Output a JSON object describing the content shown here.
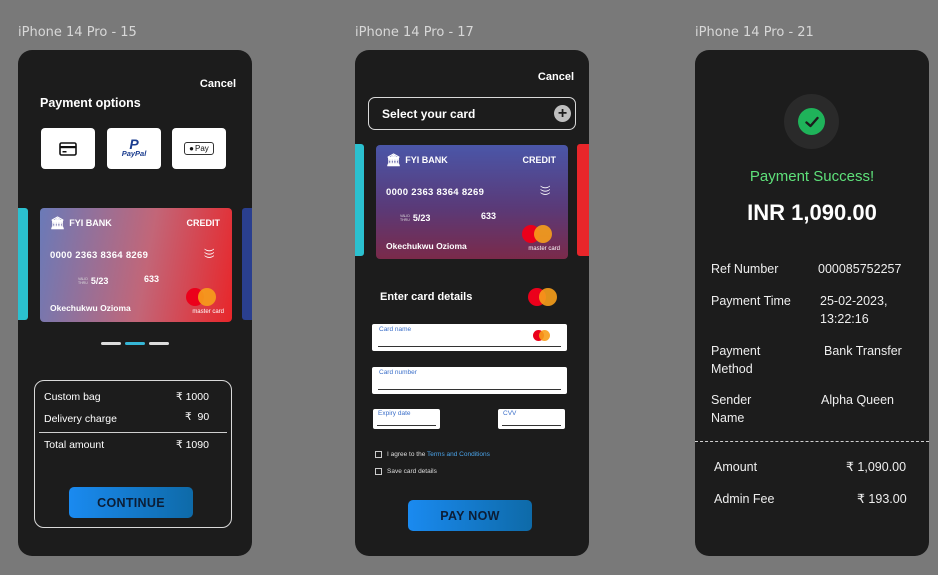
{
  "frames": [
    {
      "label": "iPhone 14 Pro - 15"
    },
    {
      "label": "iPhone 14 Pro - 17"
    },
    {
      "label": "iPhone 14 Pro - 21"
    }
  ],
  "card": {
    "bank": "FYI BANK",
    "type": "CREDIT",
    "number": "0000  2363  8364  8269",
    "valid_thru": "VALID\nTHRU",
    "expiry": "5/23",
    "cvv": "633",
    "holder": "Okechukwu Ozioma",
    "network": "master card"
  },
  "screen1": {
    "cancel": "Cancel",
    "title": "Payment options",
    "options": [
      "card-icon",
      "PayPal",
      "Pay"
    ],
    "summary": {
      "rows": [
        {
          "label": "Custom bag",
          "value": "₹ 1000"
        },
        {
          "label": "Delivery charge",
          "value": "₹  90"
        },
        {
          "label": "Total amount",
          "value": "₹ 1090"
        }
      ]
    },
    "button": "CONTINUE"
  },
  "screen2": {
    "cancel": "Cancel",
    "select_card": "Select your card",
    "enter_details": "Enter card details",
    "fields": {
      "name": "Card name",
      "number": "Card number",
      "expiry": "Expiry date",
      "cvv": "CVV"
    },
    "agree_prefix": "I agree to the ",
    "agree_link": "Terms and Conditions",
    "save_card": "Save card details",
    "button": "PAY NOW"
  },
  "screen3": {
    "status": "Payment Success!",
    "amount": "INR 1,090.00",
    "details": [
      {
        "label": "Ref Number",
        "value": "000085752257"
      },
      {
        "label": "Payment Time",
        "value": "25-02-2023,\n13:22:16"
      },
      {
        "label": "Payment\nMethod",
        "value": "Bank Transfer"
      },
      {
        "label": "Sender\nName",
        "value": "Alpha Queen"
      }
    ],
    "totals": [
      {
        "label": "Amount",
        "value": "₹ 1,090.00"
      },
      {
        "label": "Admin Fee",
        "value": "₹ 193.00"
      }
    ]
  },
  "colors": {
    "background": "#797979",
    "phone": "#1c1c1c",
    "success": "#5ee07a",
    "accent_blue": "#1a8af0",
    "link": "#4aa3e8"
  }
}
